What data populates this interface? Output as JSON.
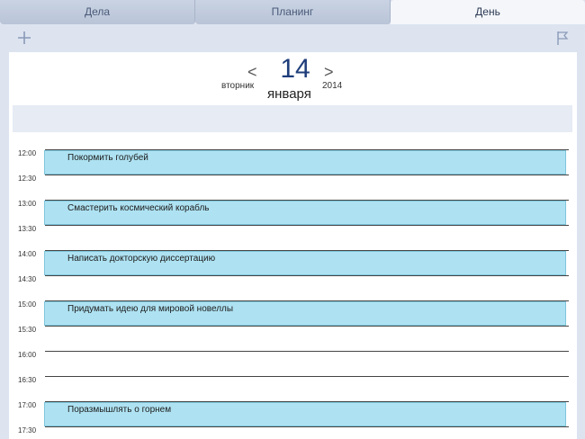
{
  "tabs": [
    {
      "label": "Дела"
    },
    {
      "label": "Планинг"
    },
    {
      "label": "День"
    }
  ],
  "toolbar": {
    "add_icon": "plus-icon",
    "flag_icon": "flag-icon"
  },
  "date": {
    "prev": "<",
    "next": ">",
    "day": "14",
    "weekday": "вторник",
    "month": "января",
    "year": "2014"
  },
  "times": [
    "12:00",
    "12:30",
    "13:00",
    "13:30",
    "14:00",
    "14:30",
    "15:00",
    "15:30",
    "16:00",
    "16:30",
    "17:00",
    "17:30"
  ],
  "events": [
    {
      "title": "Покормить голубей",
      "start": "12:00"
    },
    {
      "title": "Смастерить космический корабль",
      "start": "13:00"
    },
    {
      "title": "Написать докторскую диссертацию",
      "start": "14:00"
    },
    {
      "title": "Придумать идею для мировой новеллы",
      "start": "15:00"
    },
    {
      "title": "Поразмышлять о горнем",
      "start": "17:00"
    }
  ],
  "colors": {
    "accent": "#1e3d7a",
    "event_fill": "#aee2f2",
    "background": "#dde4f0"
  }
}
